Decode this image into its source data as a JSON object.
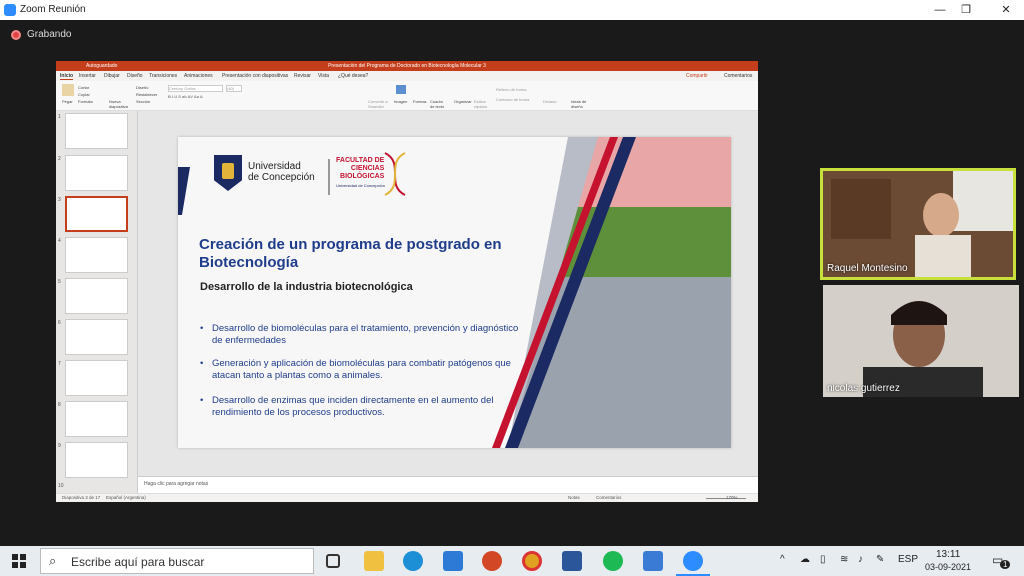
{
  "zoom": {
    "window_title": "Zoom Reunión",
    "recording_label": "Grabando"
  },
  "ppt": {
    "autosave": "Autoguardado",
    "window_title": "Presentación del Programa de Doctorado en Biotecnología Molecular 3",
    "tabs": [
      "Inicio",
      "Insertar",
      "Dibujar",
      "Diseño",
      "Transiciones",
      "Animaciones",
      "Presentación con diapositivas",
      "Revisar",
      "Vista",
      "¿Qué desea?"
    ],
    "share_label": "Compartir",
    "comments_label": "Comentarios",
    "ribbon": {
      "paste": "Pegar",
      "cut": "Cortar",
      "copy": "Copiar",
      "format": "Formato",
      "new_slide": "Nueva diapositiva",
      "layout": "Diseño",
      "reset": "Restablecer",
      "section": "Sección",
      "font_name": "Century Gothic",
      "font_size": "(40)",
      "convert_smartart": "Convertir a SmartArt",
      "image": "Imagen",
      "shapes": "Formas",
      "textbox": "Cuadro de texto",
      "organize": "Organizar",
      "quick_styles": "Estilos rápidos",
      "shape_fill": "Relleno de forma",
      "shape_outline": "Contorno de forma",
      "dictate": "Dictado",
      "design_ideas": "Ideas de diseño"
    },
    "thumb_numbers": [
      "1",
      "2",
      "3",
      "4",
      "5",
      "6",
      "7",
      "8",
      "9",
      "10"
    ],
    "notes_placeholder": "Haga clic para agregar notas",
    "status": {
      "slide_info": "Diapositiva 3 de 17",
      "language": "Español (Argentina)",
      "notes": "Notas",
      "comments": "Comentarios",
      "zoom": "170%"
    }
  },
  "slide": {
    "university_name": "Universidad\nde Concepción",
    "faculty_name": "FACULTAD DE\nCIENCIAS\nBIOLÓGICAS",
    "faculty_sub": "Universidad de Concepción",
    "title": "Creación de un programa de postgrado en Biotecnología",
    "subtitle": "Desarrollo de la industria biotecnológica",
    "bullets": [
      "Desarrollo de biomoléculas para el tratamiento, prevención y diagnóstico de enfermedades",
      "Generación y aplicación de biomoléculas para combatir patógenos que atacan tanto a plantas como a animales.",
      "Desarrollo de enzimas que inciden directamente en el aumento  del rendimiento de los procesos productivos."
    ]
  },
  "participants": [
    {
      "name": "Raquel Montesino"
    },
    {
      "name": "nicolas gutierrez"
    }
  ],
  "taskbar": {
    "search_placeholder": "Escribe aquí para buscar",
    "language": "ESP",
    "time": "13:11",
    "date": "03-09-2021",
    "notification_count": "1"
  },
  "colors": {
    "ppt_accent": "#c43e1c",
    "slide_title": "#1f3d8a",
    "speaker_highlight": "#c8e03c"
  }
}
